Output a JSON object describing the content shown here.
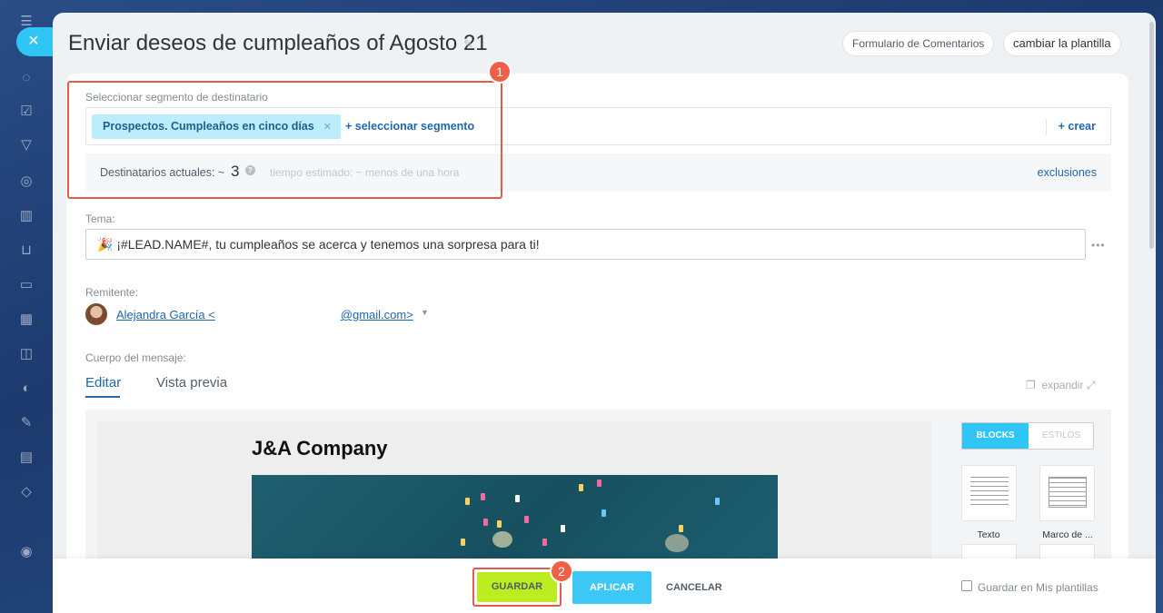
{
  "window": {
    "title": "Enviar deseos de cumpleaños of Agosto 21",
    "header_buttons": [
      "Formulario de Comentarios",
      "cambiar la plantilla"
    ]
  },
  "segment": {
    "label": "Seleccionar segmento de destinatario",
    "selected_tag": "Prospectos. Cumpleaños en cinco días",
    "add_segment": "+ seleccionar segmento",
    "create": "+ crear",
    "recipients_label": "Destinatarios actuales: ~",
    "recipients_count": "3",
    "estimated_time": "tiempo estimado: ~ menos de una hora",
    "exclusions": "exclusiones"
  },
  "subject": {
    "label": "Tema:",
    "value": "🎉 ¡#LEAD.NAME#, tu cumpleaños se acerca y tenemos una sorpresa para ti!"
  },
  "sender": {
    "label": "Remitente:",
    "name_prefix": "Alejandra García <",
    "email_suffix": "@gmail.com>"
  },
  "body": {
    "label": "Cuerpo del mensaje:",
    "tabs": [
      "Editar",
      "Vista previa"
    ],
    "expand": "expandir",
    "company_heading": "J&A Company",
    "mode_tabs": [
      "BLOCKS",
      "ESTILOS"
    ],
    "blocks": [
      "Texto",
      "Marco de ..."
    ]
  },
  "footer": {
    "save": "GUARDAR",
    "apply": "APLICAR",
    "cancel": "CANCELAR",
    "save_template": "Guardar en Mis plantillas"
  },
  "annotations": [
    "1",
    "2"
  ],
  "colors": {
    "accent": "#2fc6f6",
    "save_button": "#bbed21",
    "link": "#2067b0",
    "annotation": "#e35c4b"
  }
}
